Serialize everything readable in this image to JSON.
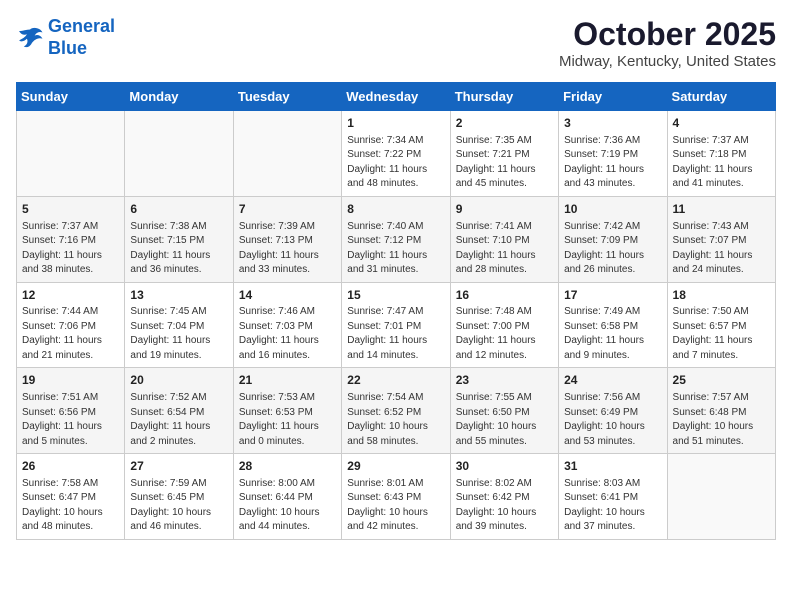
{
  "logo": {
    "line1": "General",
    "line2": "Blue"
  },
  "header": {
    "month": "October 2025",
    "location": "Midway, Kentucky, United States"
  },
  "weekdays": [
    "Sunday",
    "Monday",
    "Tuesday",
    "Wednesday",
    "Thursday",
    "Friday",
    "Saturday"
  ],
  "weeks": [
    [
      {
        "day": "",
        "sunrise": "",
        "sunset": "",
        "daylight": ""
      },
      {
        "day": "",
        "sunrise": "",
        "sunset": "",
        "daylight": ""
      },
      {
        "day": "",
        "sunrise": "",
        "sunset": "",
        "daylight": ""
      },
      {
        "day": "1",
        "sunrise": "Sunrise: 7:34 AM",
        "sunset": "Sunset: 7:22 PM",
        "daylight": "Daylight: 11 hours and 48 minutes."
      },
      {
        "day": "2",
        "sunrise": "Sunrise: 7:35 AM",
        "sunset": "Sunset: 7:21 PM",
        "daylight": "Daylight: 11 hours and 45 minutes."
      },
      {
        "day": "3",
        "sunrise": "Sunrise: 7:36 AM",
        "sunset": "Sunset: 7:19 PM",
        "daylight": "Daylight: 11 hours and 43 minutes."
      },
      {
        "day": "4",
        "sunrise": "Sunrise: 7:37 AM",
        "sunset": "Sunset: 7:18 PM",
        "daylight": "Daylight: 11 hours and 41 minutes."
      }
    ],
    [
      {
        "day": "5",
        "sunrise": "Sunrise: 7:37 AM",
        "sunset": "Sunset: 7:16 PM",
        "daylight": "Daylight: 11 hours and 38 minutes."
      },
      {
        "day": "6",
        "sunrise": "Sunrise: 7:38 AM",
        "sunset": "Sunset: 7:15 PM",
        "daylight": "Daylight: 11 hours and 36 minutes."
      },
      {
        "day": "7",
        "sunrise": "Sunrise: 7:39 AM",
        "sunset": "Sunset: 7:13 PM",
        "daylight": "Daylight: 11 hours and 33 minutes."
      },
      {
        "day": "8",
        "sunrise": "Sunrise: 7:40 AM",
        "sunset": "Sunset: 7:12 PM",
        "daylight": "Daylight: 11 hours and 31 minutes."
      },
      {
        "day": "9",
        "sunrise": "Sunrise: 7:41 AM",
        "sunset": "Sunset: 7:10 PM",
        "daylight": "Daylight: 11 hours and 28 minutes."
      },
      {
        "day": "10",
        "sunrise": "Sunrise: 7:42 AM",
        "sunset": "Sunset: 7:09 PM",
        "daylight": "Daylight: 11 hours and 26 minutes."
      },
      {
        "day": "11",
        "sunrise": "Sunrise: 7:43 AM",
        "sunset": "Sunset: 7:07 PM",
        "daylight": "Daylight: 11 hours and 24 minutes."
      }
    ],
    [
      {
        "day": "12",
        "sunrise": "Sunrise: 7:44 AM",
        "sunset": "Sunset: 7:06 PM",
        "daylight": "Daylight: 11 hours and 21 minutes."
      },
      {
        "day": "13",
        "sunrise": "Sunrise: 7:45 AM",
        "sunset": "Sunset: 7:04 PM",
        "daylight": "Daylight: 11 hours and 19 minutes."
      },
      {
        "day": "14",
        "sunrise": "Sunrise: 7:46 AM",
        "sunset": "Sunset: 7:03 PM",
        "daylight": "Daylight: 11 hours and 16 minutes."
      },
      {
        "day": "15",
        "sunrise": "Sunrise: 7:47 AM",
        "sunset": "Sunset: 7:01 PM",
        "daylight": "Daylight: 11 hours and 14 minutes."
      },
      {
        "day": "16",
        "sunrise": "Sunrise: 7:48 AM",
        "sunset": "Sunset: 7:00 PM",
        "daylight": "Daylight: 11 hours and 12 minutes."
      },
      {
        "day": "17",
        "sunrise": "Sunrise: 7:49 AM",
        "sunset": "Sunset: 6:58 PM",
        "daylight": "Daylight: 11 hours and 9 minutes."
      },
      {
        "day": "18",
        "sunrise": "Sunrise: 7:50 AM",
        "sunset": "Sunset: 6:57 PM",
        "daylight": "Daylight: 11 hours and 7 minutes."
      }
    ],
    [
      {
        "day": "19",
        "sunrise": "Sunrise: 7:51 AM",
        "sunset": "Sunset: 6:56 PM",
        "daylight": "Daylight: 11 hours and 5 minutes."
      },
      {
        "day": "20",
        "sunrise": "Sunrise: 7:52 AM",
        "sunset": "Sunset: 6:54 PM",
        "daylight": "Daylight: 11 hours and 2 minutes."
      },
      {
        "day": "21",
        "sunrise": "Sunrise: 7:53 AM",
        "sunset": "Sunset: 6:53 PM",
        "daylight": "Daylight: 11 hours and 0 minutes."
      },
      {
        "day": "22",
        "sunrise": "Sunrise: 7:54 AM",
        "sunset": "Sunset: 6:52 PM",
        "daylight": "Daylight: 10 hours and 58 minutes."
      },
      {
        "day": "23",
        "sunrise": "Sunrise: 7:55 AM",
        "sunset": "Sunset: 6:50 PM",
        "daylight": "Daylight: 10 hours and 55 minutes."
      },
      {
        "day": "24",
        "sunrise": "Sunrise: 7:56 AM",
        "sunset": "Sunset: 6:49 PM",
        "daylight": "Daylight: 10 hours and 53 minutes."
      },
      {
        "day": "25",
        "sunrise": "Sunrise: 7:57 AM",
        "sunset": "Sunset: 6:48 PM",
        "daylight": "Daylight: 10 hours and 51 minutes."
      }
    ],
    [
      {
        "day": "26",
        "sunrise": "Sunrise: 7:58 AM",
        "sunset": "Sunset: 6:47 PM",
        "daylight": "Daylight: 10 hours and 48 minutes."
      },
      {
        "day": "27",
        "sunrise": "Sunrise: 7:59 AM",
        "sunset": "Sunset: 6:45 PM",
        "daylight": "Daylight: 10 hours and 46 minutes."
      },
      {
        "day": "28",
        "sunrise": "Sunrise: 8:00 AM",
        "sunset": "Sunset: 6:44 PM",
        "daylight": "Daylight: 10 hours and 44 minutes."
      },
      {
        "day": "29",
        "sunrise": "Sunrise: 8:01 AM",
        "sunset": "Sunset: 6:43 PM",
        "daylight": "Daylight: 10 hours and 42 minutes."
      },
      {
        "day": "30",
        "sunrise": "Sunrise: 8:02 AM",
        "sunset": "Sunset: 6:42 PM",
        "daylight": "Daylight: 10 hours and 39 minutes."
      },
      {
        "day": "31",
        "sunrise": "Sunrise: 8:03 AM",
        "sunset": "Sunset: 6:41 PM",
        "daylight": "Daylight: 10 hours and 37 minutes."
      },
      {
        "day": "",
        "sunrise": "",
        "sunset": "",
        "daylight": ""
      }
    ]
  ]
}
